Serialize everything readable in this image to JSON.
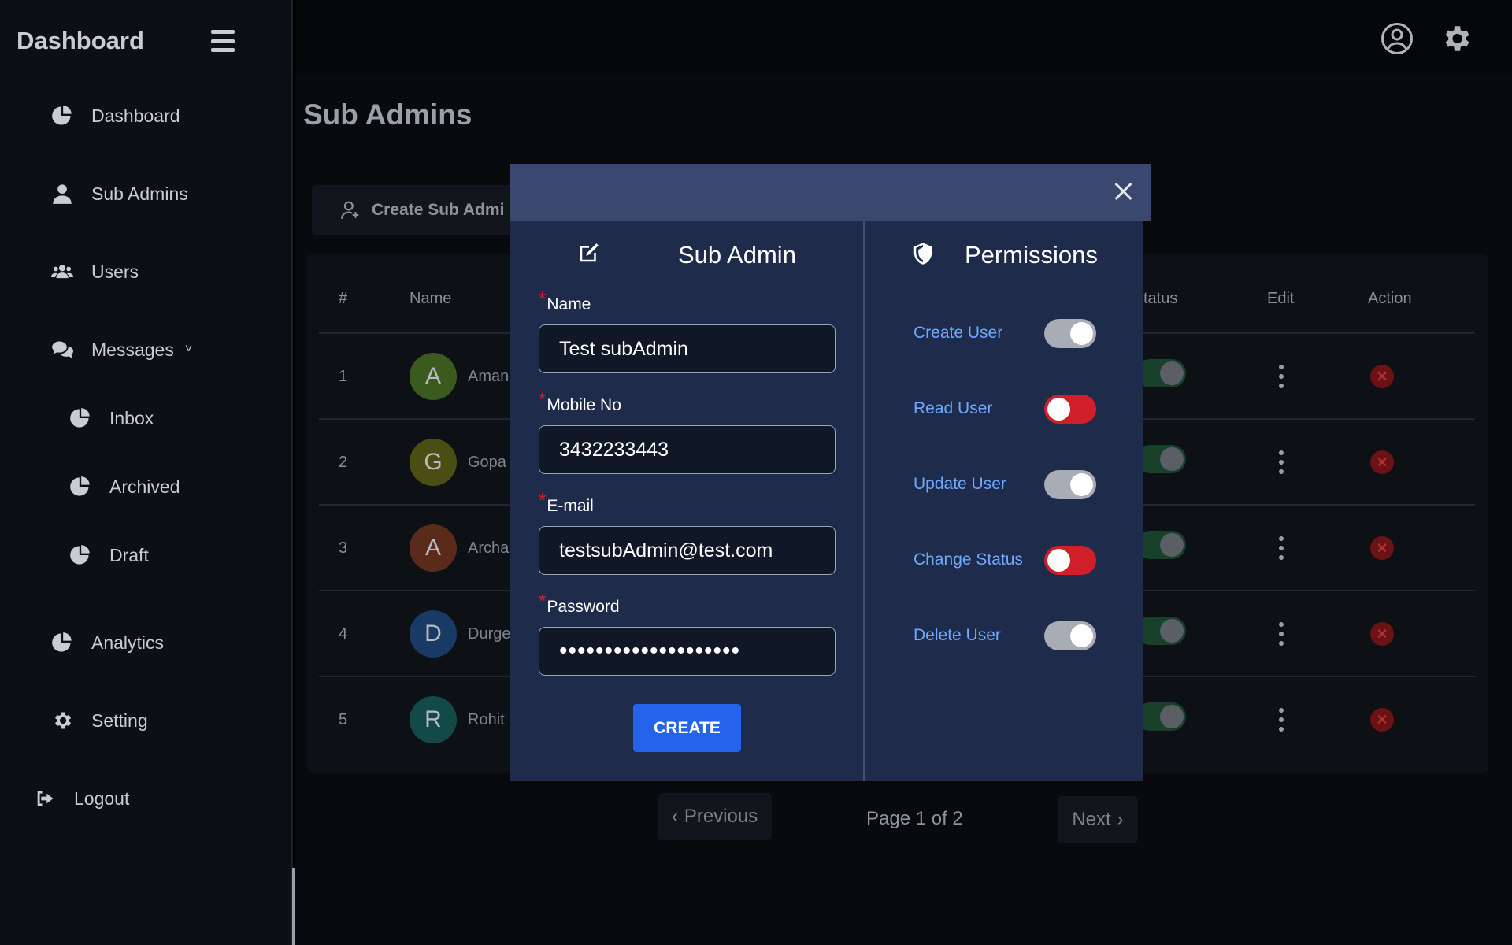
{
  "sidebar": {
    "brand": "Dashboard",
    "items": [
      {
        "label": "Dashboard",
        "icon": "pie-chart-icon"
      },
      {
        "label": "Sub Admins",
        "icon": "user-icon"
      },
      {
        "label": "Users",
        "icon": "users-icon"
      },
      {
        "label": "Messages",
        "icon": "comments-icon"
      },
      {
        "label": "Inbox",
        "icon": "pie-chart-icon"
      },
      {
        "label": "Archived",
        "icon": "pie-chart-icon"
      },
      {
        "label": "Draft",
        "icon": "pie-chart-icon"
      },
      {
        "label": "Analytics",
        "icon": "pie-chart-icon"
      },
      {
        "label": "Setting",
        "icon": "gear-icon"
      },
      {
        "label": "Logout",
        "icon": "logout-icon"
      }
    ]
  },
  "topbar": {
    "icons": [
      "user-circle-icon",
      "gear-icon"
    ]
  },
  "page": {
    "title": "Sub Admins",
    "create_button": "Create Sub Admi"
  },
  "table": {
    "headers": {
      "num": "#",
      "name": "Name",
      "status": "tatus",
      "edit": "Edit",
      "action": "Action"
    },
    "rows": [
      {
        "num": "1",
        "initial": "A",
        "name": "Aman",
        "color": "#3a5a1e"
      },
      {
        "num": "2",
        "initial": "G",
        "name": "Gopa",
        "color": "#4a4e12"
      },
      {
        "num": "3",
        "initial": "A",
        "name": "Archa",
        "color": "#5a2a1a"
      },
      {
        "num": "4",
        "initial": "D",
        "name": "Durge",
        "color": "#1a3a66"
      },
      {
        "num": "5",
        "initial": "R",
        "name": "Rohit",
        "color": "#124a4a"
      }
    ]
  },
  "pagination": {
    "previous": "Previous",
    "info": "Page 1 of 2",
    "next": "Next"
  },
  "modal": {
    "sub_admin_title": "Sub Admin",
    "permissions_title": "Permissions",
    "fields": {
      "name": {
        "label": "Name",
        "value": "Test subAdmin"
      },
      "mobile": {
        "label": "Mobile No",
        "value": "3432233443"
      },
      "email": {
        "label": "E-mail",
        "value": "testsubAdmin@test.com"
      },
      "password": {
        "label": "Password",
        "value": "••••••••••••••••••••"
      }
    },
    "submit": "CREATE",
    "permissions": [
      {
        "label": "Create User",
        "enabled": true
      },
      {
        "label": "Read User",
        "enabled": false
      },
      {
        "label": "Update User",
        "enabled": true
      },
      {
        "label": "Change Status",
        "enabled": false
      },
      {
        "label": "Delete User",
        "enabled": true
      }
    ]
  },
  "colors": {
    "modal_header": "#3a4870",
    "modal_body": "#1e2b4a",
    "accent_blue": "#2563eb",
    "permission_text": "#6ea8ff",
    "toggle_off": "#d11f2a",
    "required": "#e21b2a"
  }
}
